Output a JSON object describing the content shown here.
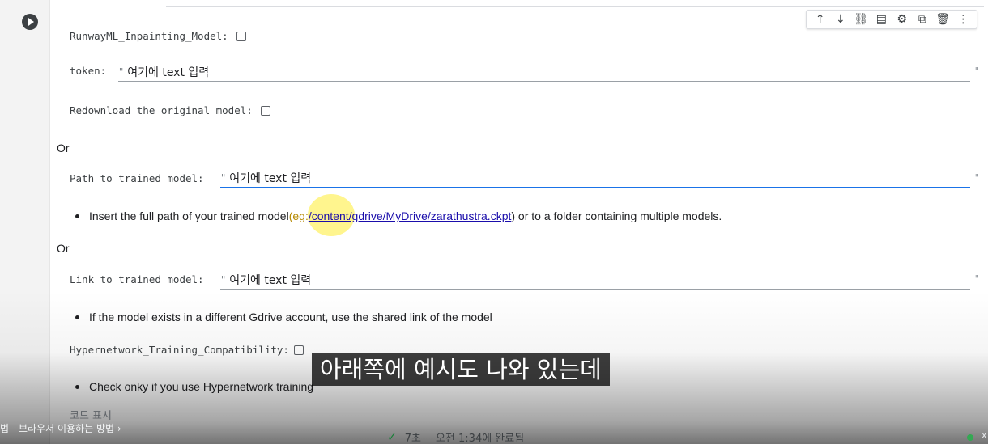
{
  "toolbar": {
    "icons": [
      "arrow-up-icon",
      "arrow-down-icon",
      "link-icon",
      "comment-icon",
      "gear-icon",
      "mirror-cell-icon",
      "delete-icon",
      "more-vert-icon"
    ],
    "glyphs": [
      "↑",
      "↓",
      "⛓",
      "▤",
      "⚙",
      "⧉",
      "🗑",
      "⋮"
    ]
  },
  "form": {
    "runway_label": "RunwayML_Inpainting_Model:",
    "token_label": "token:",
    "token_value": "여기에 text 입력",
    "redownload_label": "Redownload_the_original_model:",
    "or1": "Or",
    "path_label": "Path_to_trained_model:",
    "path_value": "여기에 text 입력",
    "path_note_pre": "Insert the full path of your trained model ",
    "path_note_eg": "(eg: ",
    "path_note_link": "/content/gdrive/MyDrive/zarathustra.ckpt",
    "path_note_post": ") or to a folder containing multiple models.",
    "or2": "Or",
    "link_label": "Link_to_trained_model:",
    "link_value": "여기에 text 입력",
    "link_note": "If the model exists in a different Gdrive account, use the shared link of the model",
    "hypernet_label": "Hypernetwork_Training_Compatibility:",
    "hypernet_note": "Check onky if you use Hypernetwork training",
    "quote_open": "\"",
    "quote_close": "\""
  },
  "show_code": "코드 표시",
  "subtitle": "아래쪽에 예시도 나와 있는데",
  "video": {
    "breadcrumb": "법 - 브라우저 이용하는 방법 ›"
  },
  "status": {
    "check": "✓",
    "duration": "7초",
    "completed": "오전 1:34에 완료됨",
    "edge": "x"
  },
  "colors": {
    "accent": "#1a73e8",
    "link": "#1a0dab",
    "highlight": "#ffec32",
    "success": "#34a853"
  }
}
